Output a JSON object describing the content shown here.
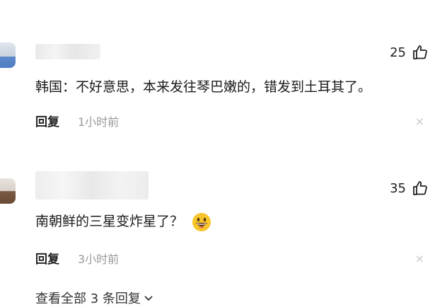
{
  "comments": [
    {
      "likes": "25",
      "text": "韩国：不好意思，本来发往琴巴嫩的，错发到土耳其了。",
      "reply_label": "回复",
      "time": "1小时前",
      "close": "×"
    },
    {
      "likes": "35",
      "text": "南朝鲜的三星变炸星了？",
      "reply_label": "回复",
      "time": "3小时前",
      "close": "×"
    }
  ],
  "view_all": "查看全部 3 条回复",
  "icons": {
    "like": "thumbs-up-icon",
    "emoji": "grinning-emoji-icon",
    "expand": "chevron-down-icon"
  },
  "colors": {
    "time": "#999999",
    "emoji": "#f7c52b"
  }
}
